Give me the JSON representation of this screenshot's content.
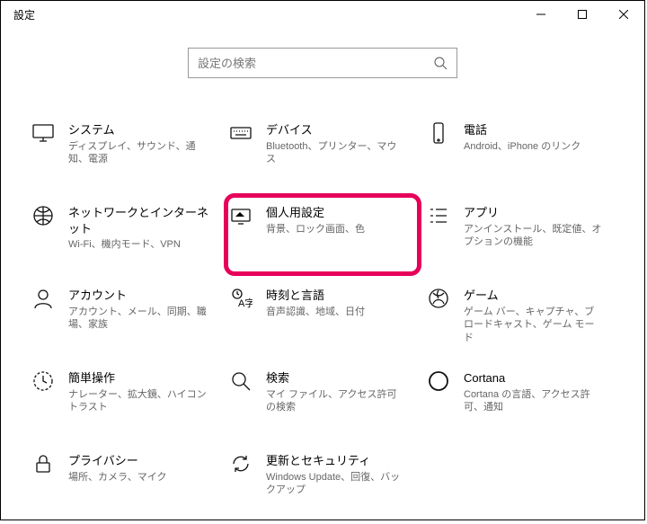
{
  "window": {
    "title": "設定"
  },
  "search": {
    "placeholder": "設定の検索"
  },
  "tiles": {
    "system": {
      "title": "システム",
      "subtitle": "ディスプレイ、サウンド、通知、電源"
    },
    "devices": {
      "title": "デバイス",
      "subtitle": "Bluetooth、プリンター、マウス"
    },
    "phone": {
      "title": "電話",
      "subtitle": "Android、iPhone のリンク"
    },
    "network": {
      "title": "ネットワークとインターネット",
      "subtitle": "Wi-Fi、機内モード、VPN"
    },
    "personal": {
      "title": "個人用設定",
      "subtitle": "背景、ロック画面、色"
    },
    "apps": {
      "title": "アプリ",
      "subtitle": "アンインストール、既定値、オプションの機能"
    },
    "accounts": {
      "title": "アカウント",
      "subtitle": "アカウント、メール、同期、職場、家族"
    },
    "time": {
      "title": "時刻と言語",
      "subtitle": "音声認識、地域、日付"
    },
    "gaming": {
      "title": "ゲーム",
      "subtitle": "ゲーム バー、キャプチャ、ブロードキャスト、ゲーム モード"
    },
    "ease": {
      "title": "簡単操作",
      "subtitle": "ナレーター、拡大鏡、ハイコントラスト"
    },
    "search_tile": {
      "title": "検索",
      "subtitle": "マイ ファイル、アクセス許可の検索"
    },
    "cortana": {
      "title": "Cortana",
      "subtitle": "Cortana の言語、アクセス許可、通知"
    },
    "privacy": {
      "title": "プライバシー",
      "subtitle": "場所、カメラ、マイク"
    },
    "update": {
      "title": "更新とセキュリティ",
      "subtitle": "Windows Update、回復、バックアップ"
    }
  }
}
